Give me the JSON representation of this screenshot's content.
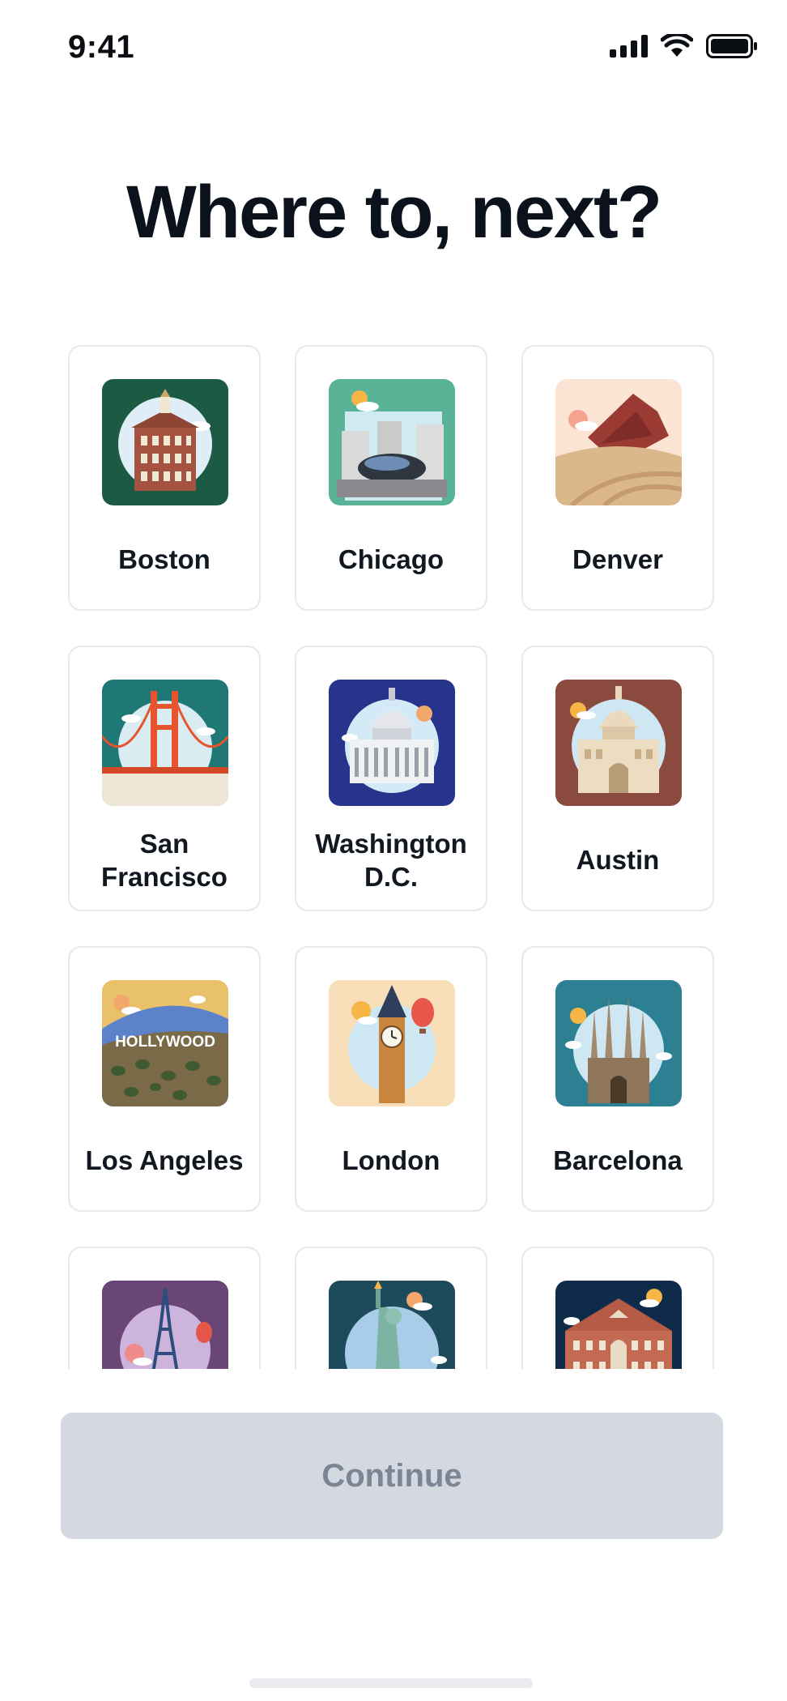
{
  "status_bar": {
    "time": "9:41"
  },
  "page": {
    "title": "Where to, next?"
  },
  "cities": [
    {
      "label": "Boston",
      "bg": "#1d5a44",
      "icon": "boston-faneuil-hall-icon"
    },
    {
      "label": "Chicago",
      "bg": "#5bb397",
      "icon": "chicago-bean-icon"
    },
    {
      "label": "Denver",
      "bg": "#fbe4d3",
      "icon": "denver-red-rocks-icon"
    },
    {
      "label": "San Francisco",
      "bg": "#1f7776",
      "icon": "golden-gate-bridge-icon"
    },
    {
      "label": "Washington D.C.",
      "bg": "#27348b",
      "icon": "capitol-building-icon"
    },
    {
      "label": "Austin",
      "bg": "#8a4a3d",
      "icon": "texas-capitol-icon"
    },
    {
      "label": "Los Angeles",
      "bg": "#e9c16a",
      "icon": "hollywood-sign-icon",
      "sign_text": "HOLLYWOOD"
    },
    {
      "label": "London",
      "bg": "#f8dfba",
      "icon": "big-ben-icon"
    },
    {
      "label": "Barcelona",
      "bg": "#2d7f92",
      "icon": "sagrada-familia-icon"
    },
    {
      "label": "",
      "bg": "#6a4676",
      "icon": "eiffel-tower-icon"
    },
    {
      "label": "",
      "bg": "#1e4b5b",
      "icon": "statue-of-liberty-icon"
    },
    {
      "label": "",
      "bg": "#0f2b4a",
      "icon": "nashville-ryman-icon"
    }
  ],
  "actions": {
    "continue_label": "Continue"
  },
  "colors": {
    "button_disabled_bg": "#d4d8e1",
    "button_disabled_text": "#7c8593",
    "card_border": "#e6e8ec"
  }
}
